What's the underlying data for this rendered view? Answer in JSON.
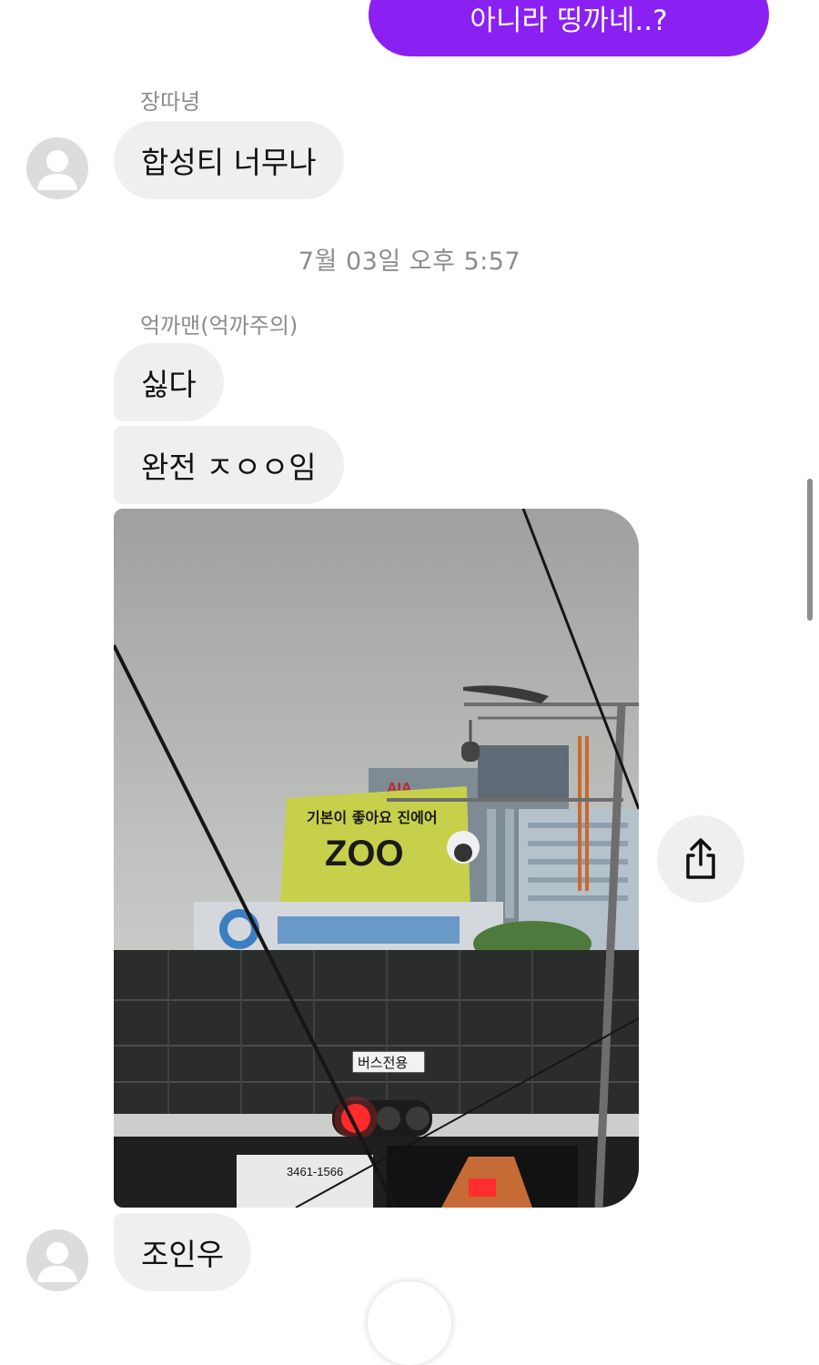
{
  "messages": {
    "outgoing_text": "아니라 띵까네..?",
    "group1": {
      "sender": "장따녕",
      "text": "합성티 너무나"
    },
    "timestamp": "7월 03일 오후 5:57",
    "group2": {
      "sender": "억까맨(억까주의)",
      "text1": "싫다",
      "text2": "완전 ㅈㅇㅇ임",
      "photo": {
        "billboard_line1": "기본이 좋아요 진에어",
        "billboard_big": "ZOO",
        "bus_sign": "버스전용",
        "phone_sign": "3461-1566",
        "top_sign": "AIA"
      }
    },
    "group3": {
      "text": "조인우"
    }
  },
  "colors": {
    "outgoing_bubble": "#8a20f2",
    "incoming_bubble": "#efefef",
    "meta_text": "#8c8c8c"
  },
  "icons": {
    "share": "share-icon",
    "avatar": "default-avatar-icon"
  }
}
